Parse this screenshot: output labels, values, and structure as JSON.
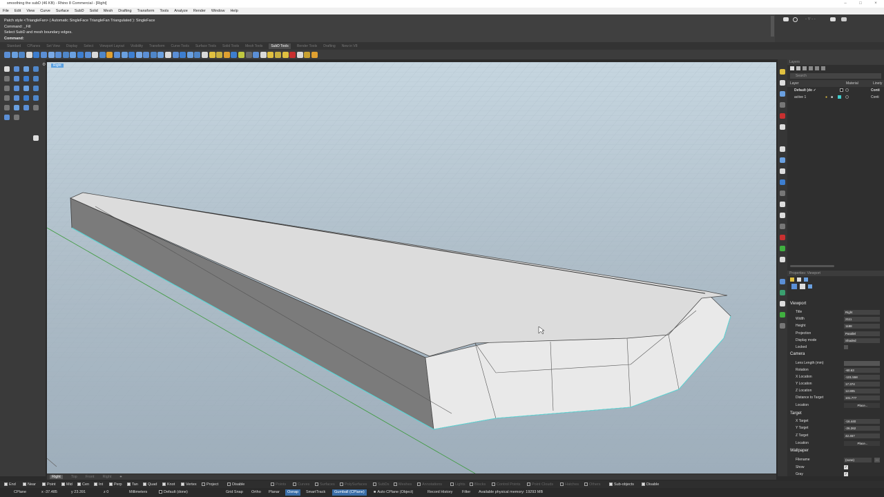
{
  "titlebar": {
    "text": "smoothing the subD (46 KB) - Rhino 8 Commercial - [Right]"
  },
  "menu": [
    "File",
    "Edit",
    "View",
    "Curve",
    "Surface",
    "SubD",
    "Solid",
    "Mesh",
    "Drafting",
    "Transform",
    "Tools",
    "Analyze",
    "Render",
    "Window",
    "Help"
  ],
  "command": {
    "history": [
      "Patch style <TriangleFan> ( Automatic  SingleFace  TriangleFan  Triangulated ): SingleFace",
      "Command: _Fill",
      "Select SubD and mesh boundary edges."
    ],
    "prompt": "Command:"
  },
  "tabs": [
    "Standard",
    "CPlanes",
    "Set View",
    "Display",
    "Select",
    "Viewport Layout",
    "Visibility",
    "Transform",
    "Curve Tools",
    "Surface Tools",
    "Solid Tools",
    "Mesh Tools",
    "SubD Tools",
    "Render Tools",
    "Drafting",
    "New in V8"
  ],
  "active_tab": "SubD Tools",
  "viewport": {
    "title": "Right",
    "tabs": [
      "Right",
      "Top",
      "Front",
      "Right"
    ],
    "accent": "#5aa0e0"
  },
  "layers": {
    "panel_title": "Layers",
    "search_placeholder": "Search",
    "columns": [
      "Layer",
      "Material",
      "Linety"
    ],
    "rows": [
      {
        "name": "Default (do ✓",
        "linetype": "Conti"
      },
      {
        "name": "active 1",
        "linetype": "Conti"
      }
    ]
  },
  "properties": {
    "panel_title": "Properties: Viewport",
    "viewport_section": "Viewport",
    "viewport_rows": [
      {
        "label": "Title",
        "value": "Right"
      },
      {
        "label": "Width",
        "value": "2111"
      },
      {
        "label": "Height",
        "value": "1188"
      },
      {
        "label": "Projection",
        "value": "Parallel"
      },
      {
        "label": "Display mode",
        "value": "Shaded"
      },
      {
        "label": "Locked",
        "value": ""
      }
    ],
    "camera_section": "Camera",
    "camera_rows": [
      {
        "label": "Lens Length (mm)",
        "value": ""
      },
      {
        "label": "Rotation",
        "value": "-60.63"
      },
      {
        "label": "X Location",
        "value": "-101.558"
      },
      {
        "label": "Y Location",
        "value": "17.374"
      },
      {
        "label": "Z Location",
        "value": "12.805"
      },
      {
        "label": "Distance to Target",
        "value": "101.777"
      },
      {
        "label": "Location",
        "value": "Place..."
      }
    ],
    "target_section": "Target",
    "target_rows": [
      {
        "label": "X Target",
        "value": "-16.440"
      },
      {
        "label": "Y Target",
        "value": "-26.262"
      },
      {
        "label": "Z Target",
        "value": "42.457"
      },
      {
        "label": "Location",
        "value": "Place..."
      }
    ],
    "wallpaper_section": "Wallpaper",
    "wallpaper_rows": [
      {
        "label": "Filename",
        "value": "(none)"
      },
      {
        "label": "Show",
        "value": ""
      },
      {
        "label": "Gray",
        "value": ""
      }
    ]
  },
  "osnaps": [
    "End",
    "Near",
    "Point",
    "Mid",
    "Cen",
    "Int",
    "Perp",
    "Tan",
    "Quad",
    "Knot",
    "Vertex",
    "Project",
    "Disable"
  ],
  "selection_filters": [
    "Points",
    "Curves",
    "Surfaces",
    "PolySurfaces",
    "SubDs",
    "Meshes",
    "Annotations",
    "Lights",
    "Blocks",
    "Control Points",
    "Point Clouds",
    "Hatches",
    "Others",
    "Sub-objects",
    "Disable"
  ],
  "status": {
    "cplane": "CPlane",
    "x": "x -37.485",
    "y": "y 23.391",
    "z": "z 0",
    "units": "Millimeters",
    "layer": "Default (done)",
    "grid_snap": "Grid Snap",
    "ortho": "Ortho",
    "planar": "Planar",
    "osnap": "Osnap",
    "smarttrack": "SmartTrack",
    "gumball": "Gumball (CPlane)",
    "auto_cplane": "Auto CPlane (Object)",
    "record_history": "Record History",
    "filter": "Filter",
    "memory": "Available physical memory: 19293 MB"
  }
}
